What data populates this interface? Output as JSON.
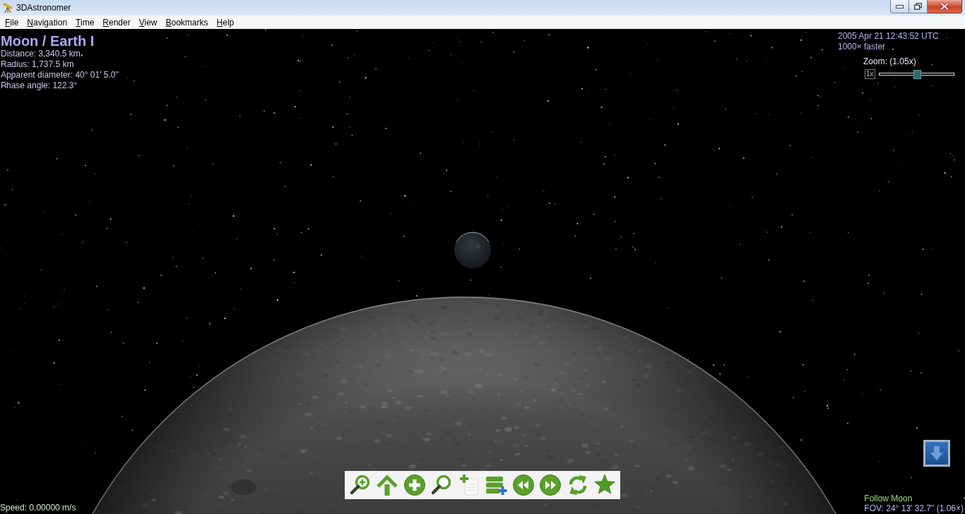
{
  "window": {
    "title": "3DAstronomer"
  },
  "menu": [
    "File",
    "Navigation",
    "Time",
    "Render",
    "View",
    "Bookmarks",
    "Help"
  ],
  "object_info": {
    "name": "Moon / Earth I",
    "details": [
      "Distance: 3,340.5 km",
      "Radius: 1,737.5 km",
      "Apparent diameter: 40° 01' 5.0\"",
      "Phase angle: 122.3°"
    ]
  },
  "time": {
    "date": "2005 Apr 21 12:43:52 UTC",
    "rate": "1000× faster"
  },
  "zoom": {
    "label": "Zoom: (1.05x)",
    "reset": "1x",
    "level": 0.51
  },
  "toolbar": {
    "buttons": [
      {
        "kind": "zoomin"
      },
      {
        "kind": "house"
      },
      {
        "kind": "add"
      },
      {
        "kind": "search"
      },
      {
        "kind": "addpage"
      },
      {
        "kind": "addlayer"
      },
      {
        "kind": "rewind"
      },
      {
        "kind": "forward"
      },
      {
        "kind": "refresh"
      },
      {
        "kind": "star"
      }
    ]
  },
  "status": {
    "speed": "Speed: 0.00000 m/s",
    "follow": "Follow Moon",
    "fov": "FOV: 24° 13' 32.7\" (1.06×)"
  }
}
